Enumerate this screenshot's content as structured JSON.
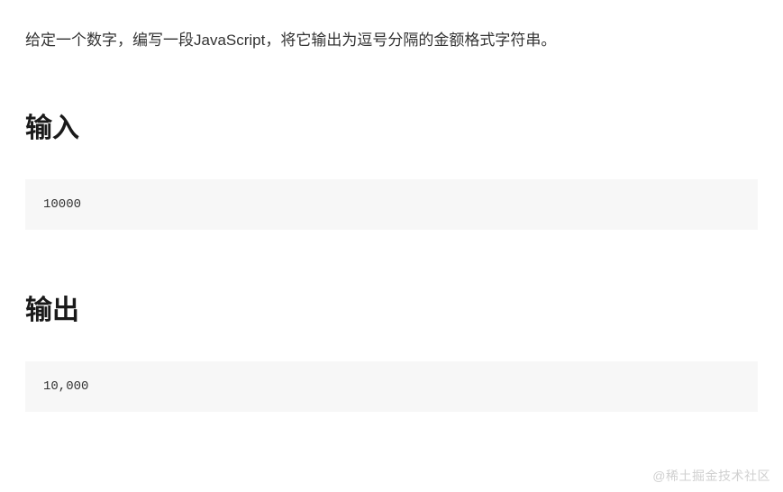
{
  "description": "给定一个数字，编写一段JavaScript，将它输出为逗号分隔的金额格式字符串。",
  "sections": {
    "input": {
      "heading": "输入",
      "code": "10000"
    },
    "output": {
      "heading": "输出",
      "code": "10,000"
    }
  },
  "watermark": "@稀土掘金技术社区"
}
